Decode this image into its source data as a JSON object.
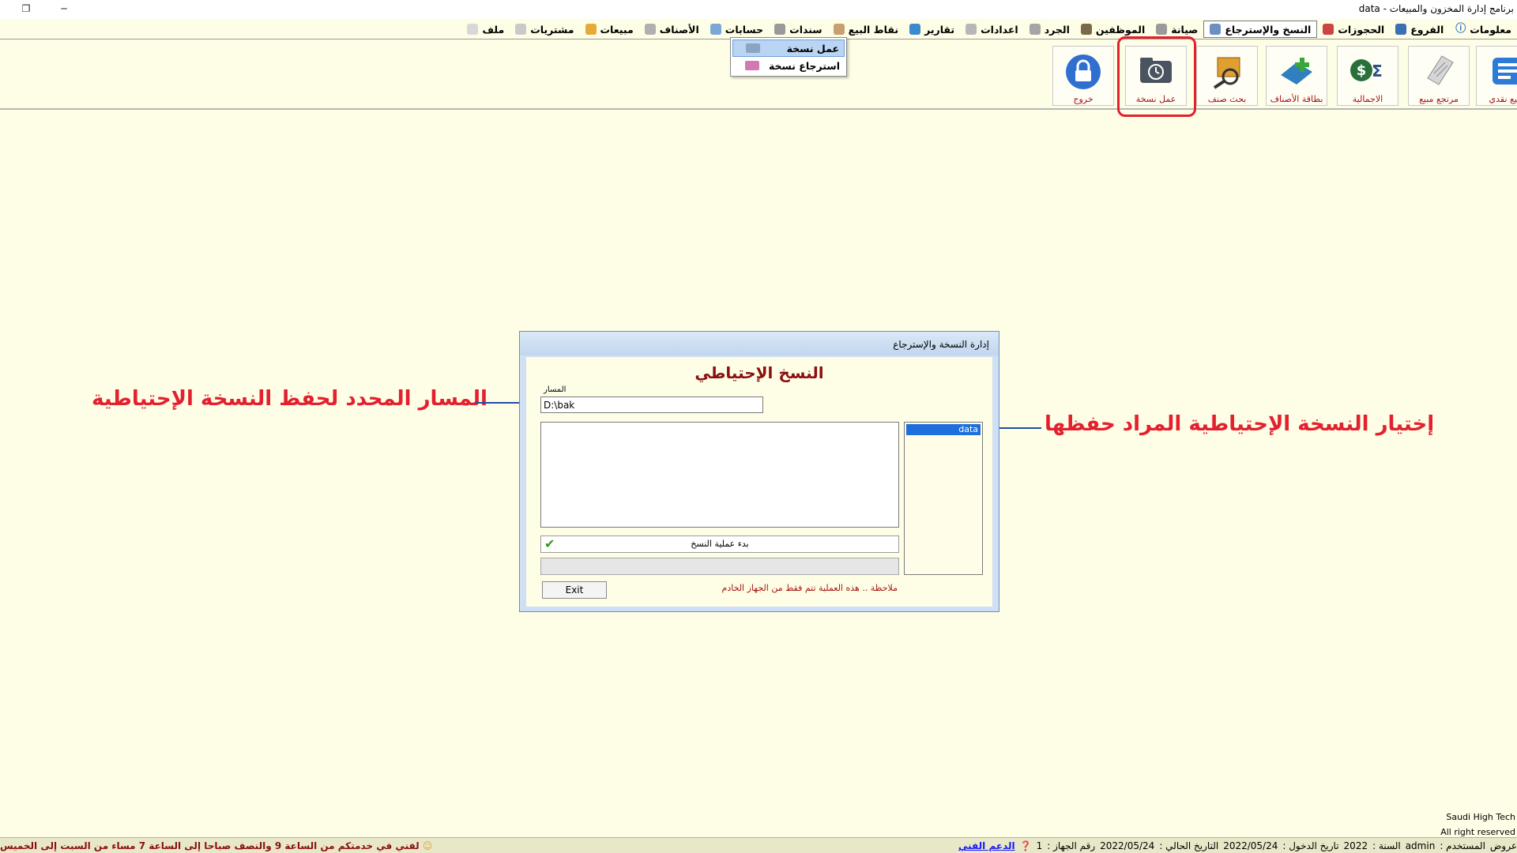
{
  "window": {
    "title": "برنامج إدارة المخزون والمبيعات - data"
  },
  "menubar": {
    "items": [
      {
        "label": "ملف",
        "icon": "file-icon",
        "color": "#d8d8d8"
      },
      {
        "label": "مشتريات",
        "icon": "document-icon",
        "color": "#c9c9c9"
      },
      {
        "label": "مبيعات",
        "icon": "cart-icon",
        "color": "#e6a93a"
      },
      {
        "label": "الأصناف",
        "icon": "item-icon",
        "color": "#b0b0b0"
      },
      {
        "label": "حسابات",
        "icon": "accounts-icon",
        "color": "#7aa6d8"
      },
      {
        "label": "سندات",
        "icon": "voucher-icon",
        "color": "#9a9a9a"
      },
      {
        "label": "نقاط البيع",
        "icon": "pos-icon",
        "color": "#c7a070"
      },
      {
        "label": "تقارير",
        "icon": "report-icon",
        "color": "#3a8ad0"
      },
      {
        "label": "اعدادات",
        "icon": "settings-icon",
        "color": "#b7b7b7"
      },
      {
        "label": "الجرد",
        "icon": "inventory-icon",
        "color": "#a5a5a5"
      },
      {
        "label": "الموظفين",
        "icon": "employee-icon",
        "color": "#7a6a4a"
      },
      {
        "label": "صيانة",
        "icon": "maintenance-icon",
        "color": "#9a9a9a"
      },
      {
        "label": "النسخ والإسترجاع",
        "icon": "backup-icon",
        "color": "#6a8fc0"
      },
      {
        "label": "الحجوزات",
        "icon": "booking-icon",
        "color": "#c44"
      },
      {
        "label": "الفروع",
        "icon": "branches-icon",
        "color": "#3b6fb6"
      },
      {
        "label": "معلومات",
        "icon": "info-icon",
        "color": ""
      }
    ],
    "dropdown": [
      {
        "label": "عمل نسخة",
        "icon": "backup-icon",
        "color": "#8aa4c4"
      },
      {
        "label": "استرجاع نسخة",
        "icon": "restore-icon",
        "color": "#d07ab0"
      }
    ]
  },
  "toolbar": {
    "buttons": [
      {
        "label": "مبيع نقدي",
        "icon": "cash-sale-icon",
        "color": "#2c7bd6"
      },
      {
        "label": "مرتجع مبيع",
        "icon": "sale-return-icon",
        "color": "#bdbdbd"
      },
      {
        "label": "الاجمالية",
        "icon": "totals-icon",
        "color": "#2a6f3a"
      },
      {
        "label": "بطاقة الأصناف",
        "icon": "item-card-icon",
        "color": "#2f7fc1"
      },
      {
        "label": "بحث صنف",
        "icon": "item-search-icon",
        "color": "#e0a030"
      },
      {
        "label": "عمل نسخة",
        "icon": "backup-icon",
        "color": "#4a5460"
      },
      {
        "label": "خروج",
        "icon": "lock-icon",
        "color": "#2f6fd0"
      }
    ]
  },
  "dialog": {
    "title": "إدارة النسخة والإسترجاع",
    "heading": "النسخ الإحتياطي",
    "path_label": "المسار",
    "path_value": "D:\\bak",
    "databases": [
      "data"
    ],
    "start_label": "بدء عملية النسخ",
    "exit_label": "Exit",
    "note": "ملاحظة .. هذه العملية تتم فقط من الجهاز الخادم"
  },
  "annotations": {
    "path": "المسار المحدد لحفظ النسخة الإحتياطية",
    "select": "إختيار النسخة الإحتياطية المراد حفظها"
  },
  "footer": {
    "company": "Saudi High Tech",
    "rights": "All right reserved"
  },
  "statusbar": {
    "offers": "عروض",
    "user_label": "المستخدم :",
    "user": "admin",
    "year_label": "السنة :",
    "year": "2022",
    "login_label": "تاريخ الدخول :",
    "login_date": "2022/05/24",
    "current_label": "التاريخ الحالي :",
    "current_date": "2022/05/24",
    "device_label": "رقم الجهاز :",
    "device": "1",
    "support": "الدعم الفني",
    "marquee": "لفني في خدمتكم من الساعة 9 والنصف صباحا إلى الساعة 7 مساء من السبت إلى الخميس"
  }
}
